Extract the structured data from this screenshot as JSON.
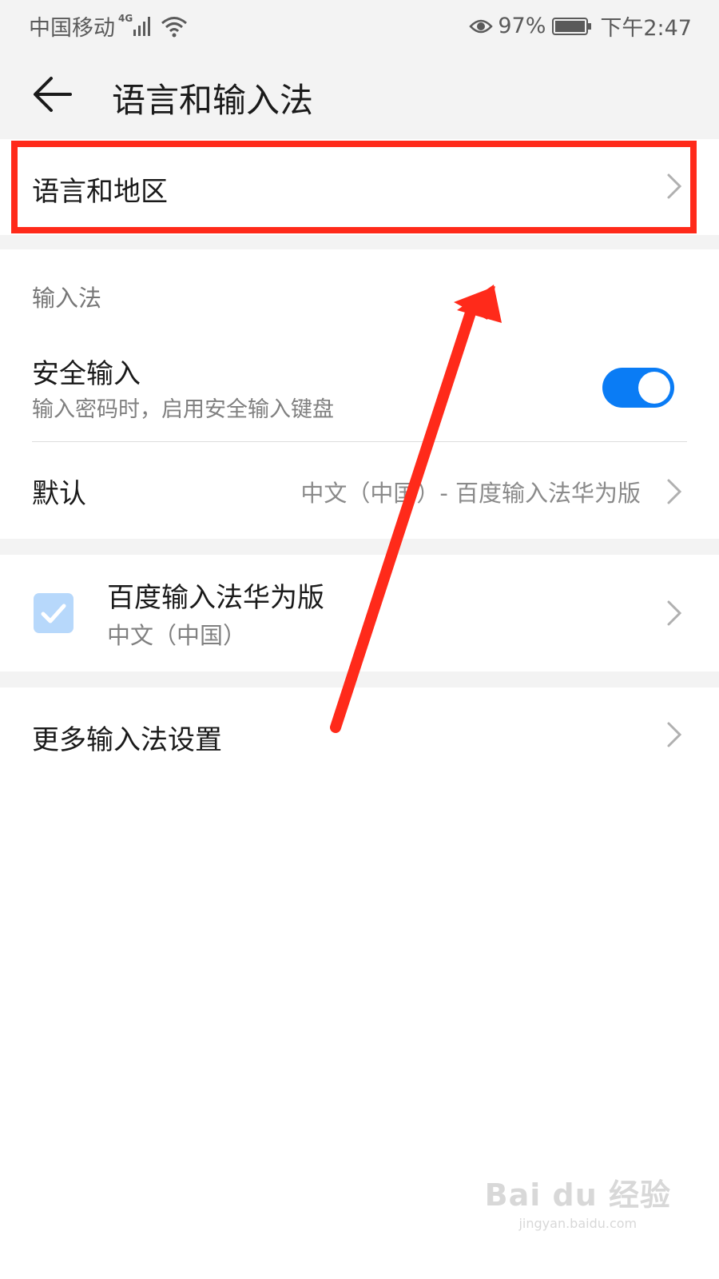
{
  "status_bar": {
    "carrier": "中国移动",
    "network": "4G",
    "battery": "97%",
    "time": "下午2:47"
  },
  "header": {
    "title": "语言和输入法",
    "back_icon": "arrow-left-icon"
  },
  "language_region": {
    "label": "语言和地区"
  },
  "input_method_section": {
    "title": "输入法",
    "secure_input": {
      "title": "安全输入",
      "subtitle": "输入密码时，启用安全输入键盘",
      "enabled": true
    },
    "default": {
      "label": "默认",
      "value": "中文（中国）- 百度输入法华为版"
    }
  },
  "baidu_ime": {
    "title": "百度输入法华为版",
    "subtitle": "中文（中国）",
    "checked": true
  },
  "more_settings": {
    "label": "更多输入法设置"
  },
  "watermark": {
    "brand": "Bai du 经验",
    "url": "jingyan.baidu.com"
  },
  "colors": {
    "accent": "#0a7cf5",
    "highlight": "#ff2a1a",
    "background": "#f3f3f3",
    "checkbox": "#b7d8fb"
  }
}
